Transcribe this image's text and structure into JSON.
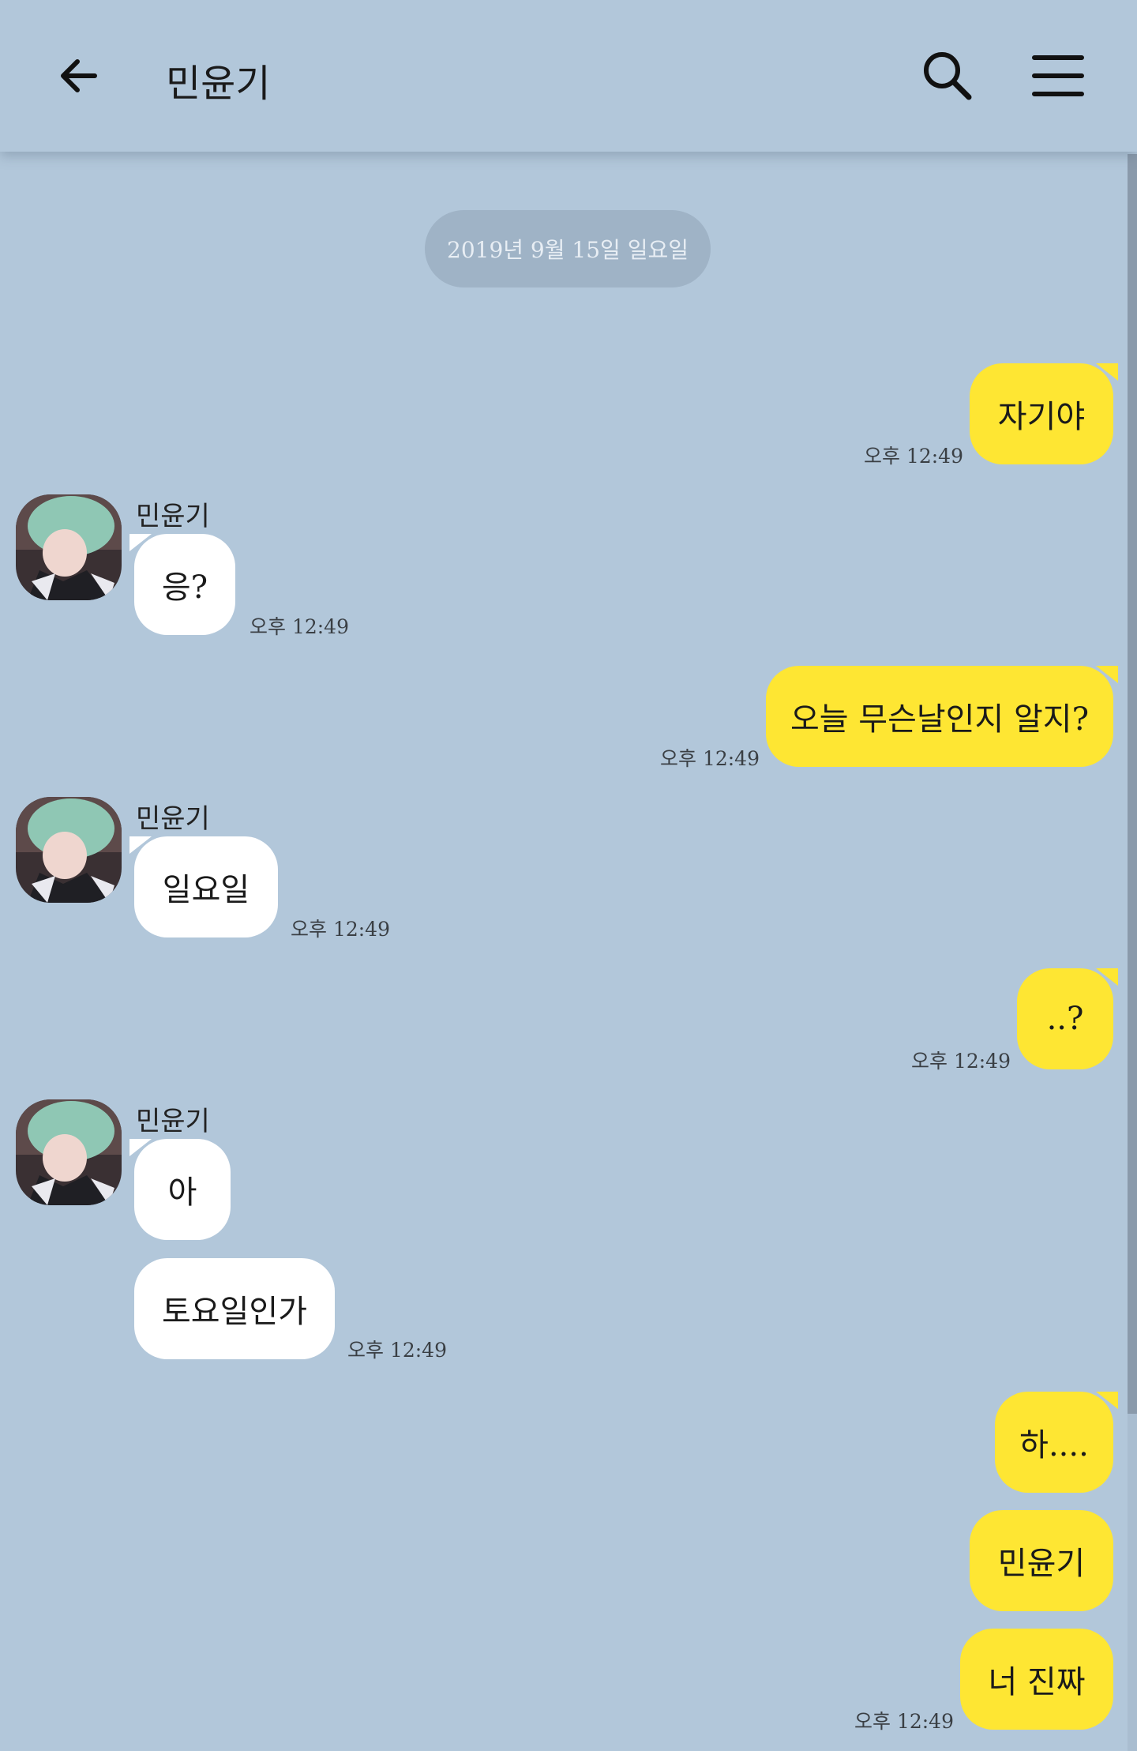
{
  "header": {
    "title": "민윤기",
    "back_icon": "arrow-left-icon",
    "search_icon": "search-icon",
    "menu_icon": "hamburger-menu-icon"
  },
  "date_divider": "2019년 9월 15일 일요일",
  "colors": {
    "background": "#b2c7da",
    "my_bubble": "#fee633",
    "their_bubble": "#ffffff",
    "date_pill": "#9fb3c6"
  },
  "messages": [
    {
      "from": "me",
      "text": "자기야",
      "time": "오후 12:49"
    },
    {
      "from": "them",
      "sender": "민윤기",
      "text": "응?",
      "time": "오후 12:49"
    },
    {
      "from": "me",
      "text": "오늘 무슨날인지 알지?",
      "time": "오후 12:49"
    },
    {
      "from": "them",
      "sender": "민윤기",
      "text": "일요일",
      "time": "오후 12:49"
    },
    {
      "from": "me",
      "text": "..?",
      "time": "오후 12:49"
    },
    {
      "from": "them",
      "sender": "민윤기",
      "text": "아",
      "time": ""
    },
    {
      "from": "them",
      "text": "토요일인가",
      "time": "오후 12:49"
    },
    {
      "from": "me",
      "text": "하....",
      "time": ""
    },
    {
      "from": "me",
      "text": "민윤기",
      "time": ""
    },
    {
      "from": "me",
      "text": "너 진짜",
      "time": "오후 12:49"
    }
  ]
}
